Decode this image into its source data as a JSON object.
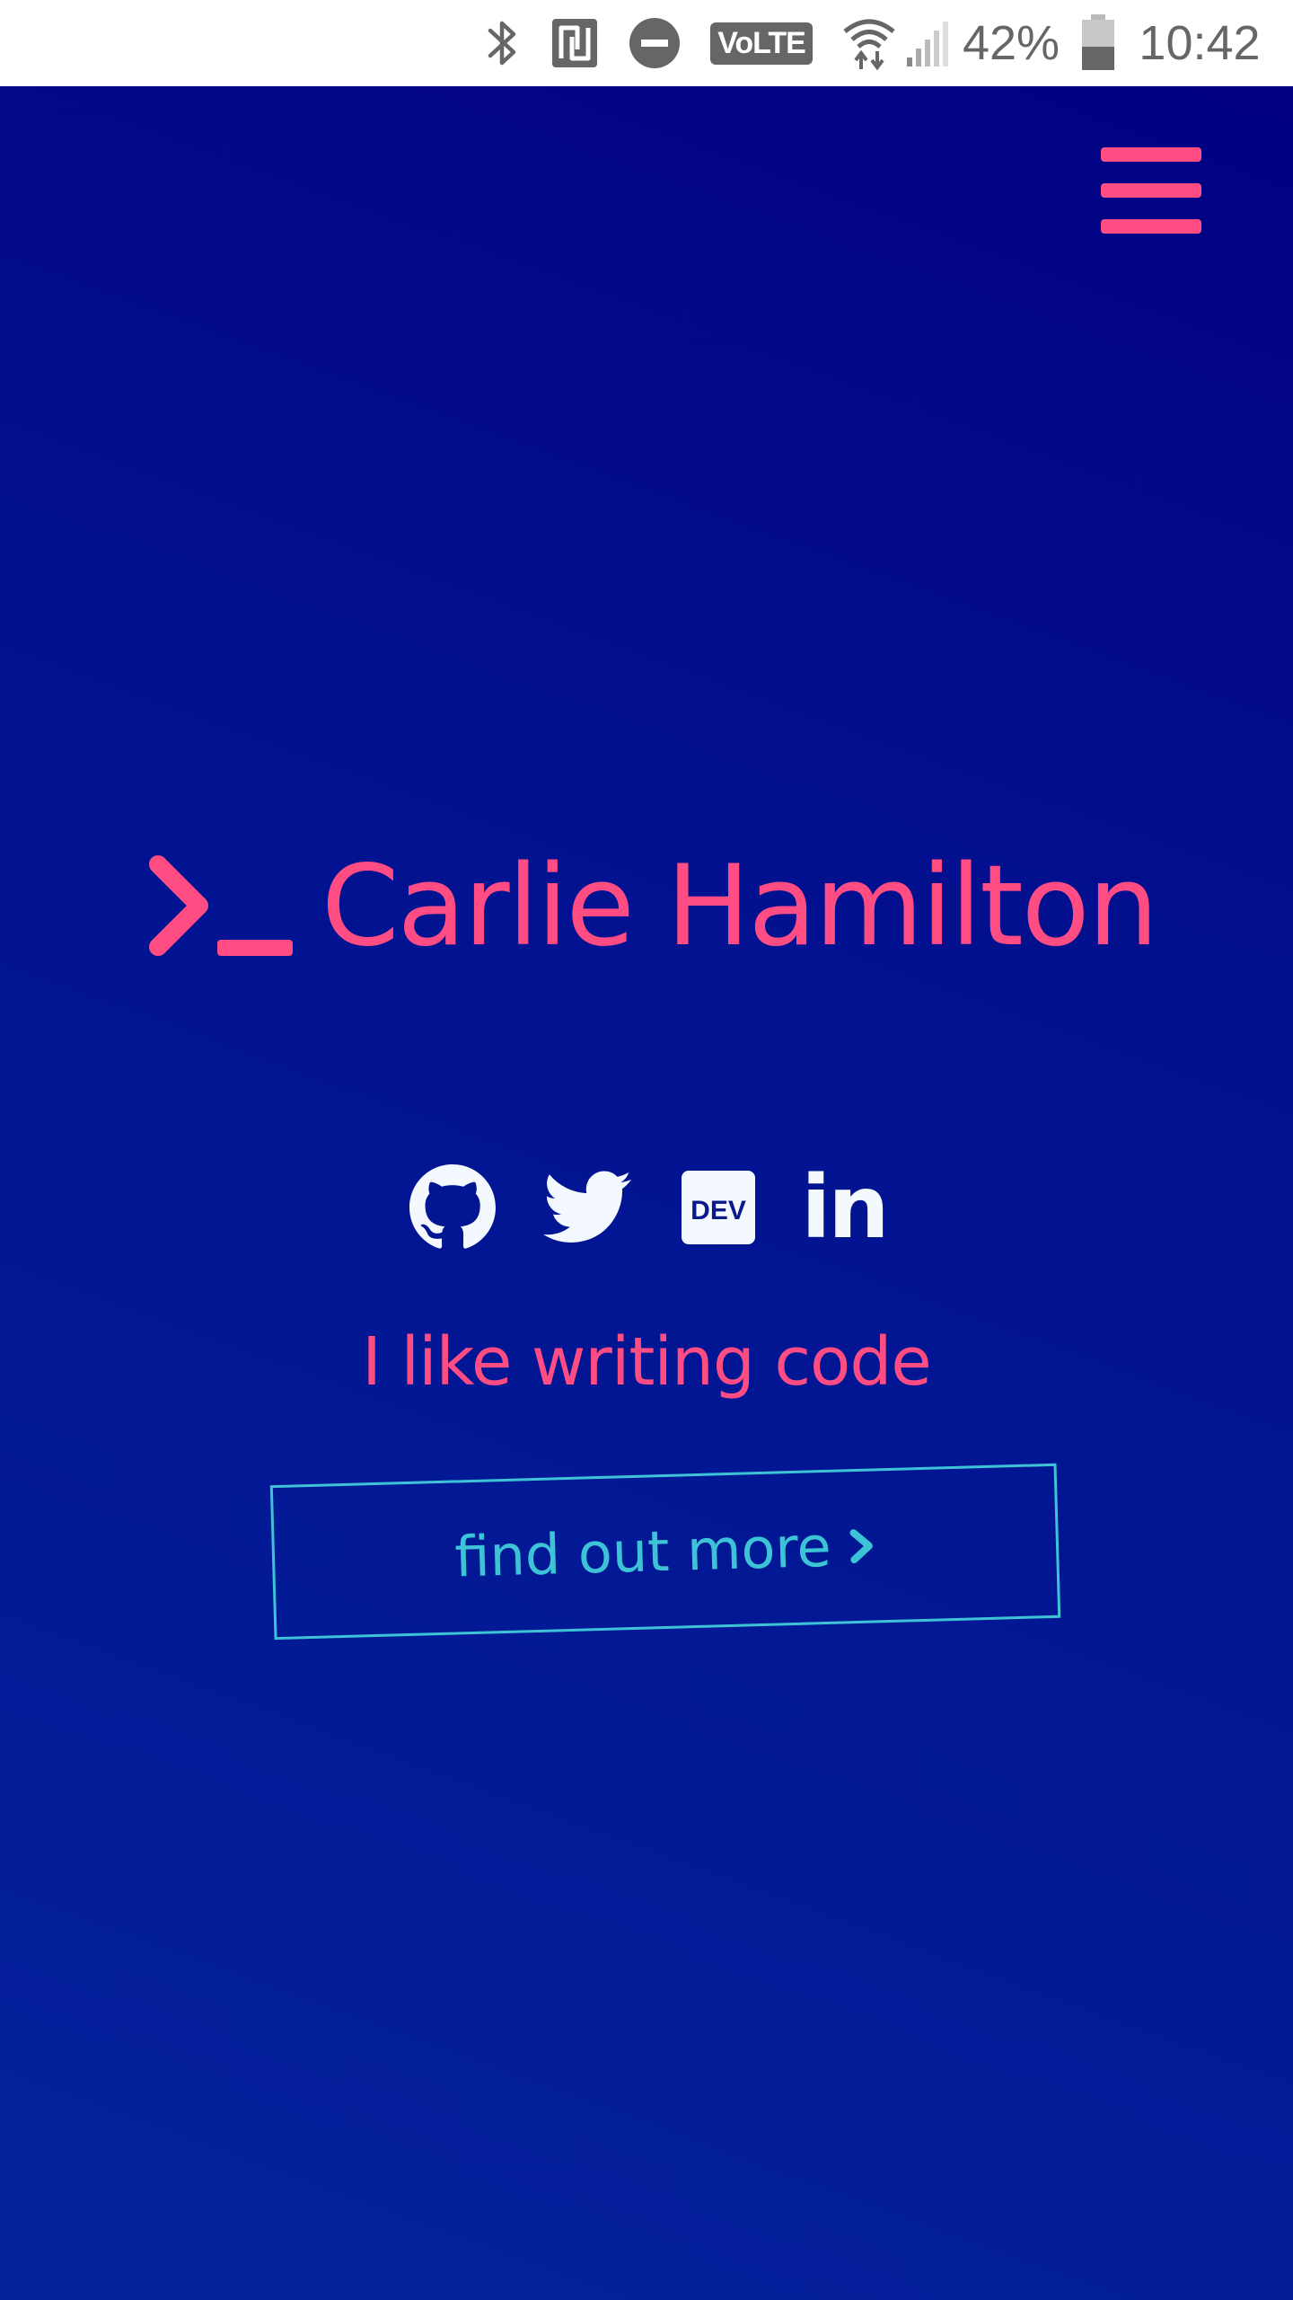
{
  "status_bar": {
    "battery_percent": "42%",
    "time": "10:42",
    "volte_label": "VoLTE",
    "icons": [
      "bluetooth-icon",
      "nfc-icon",
      "do-not-disturb-icon",
      "volte-icon",
      "wifi-icon",
      "cell-signal-icon",
      "battery-icon"
    ]
  },
  "header": {
    "menu_icon": "hamburger-menu-icon"
  },
  "hero": {
    "prompt_icon": "terminal-prompt-icon",
    "name": "Carlie Hamilton",
    "socials": [
      {
        "name": "GitHub",
        "icon": "github-icon"
      },
      {
        "name": "Twitter",
        "icon": "twitter-icon"
      },
      {
        "name": "DEV",
        "icon": "dev-icon",
        "label": "DEV"
      },
      {
        "name": "LinkedIn",
        "icon": "linkedin-icon",
        "label": "in"
      }
    ],
    "tagline": "I like writing code",
    "cta_label": "find out more",
    "cta_icon": "chevron-right-icon"
  },
  "colors": {
    "accent_pink": "#ff4d84",
    "accent_teal": "#3cc4d6",
    "background_navy": "#010082",
    "icon_white": "#f4f8ff"
  }
}
